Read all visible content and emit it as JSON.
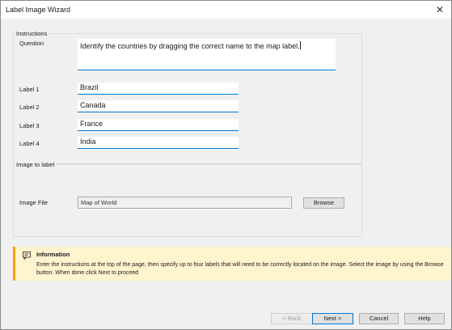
{
  "window": {
    "title": "Label Image Wizard",
    "close_glyph": "✕"
  },
  "instructions": {
    "legend": "Instructions",
    "question_label": "Question",
    "question_value": "Identify the countries by dragging the correct name to the map label.",
    "labels": [
      {
        "label": "Label 1",
        "value": "Brazil"
      },
      {
        "label": "Label 2",
        "value": "Canada"
      },
      {
        "label": "Label 3",
        "value": "France"
      },
      {
        "label": "Label 4",
        "value": "India"
      }
    ]
  },
  "image_section": {
    "legend": "Image to label",
    "file_label": "Image File",
    "file_value": "Map of World",
    "browse_label": "Browse"
  },
  "info": {
    "title": "Information",
    "body": "Enter the instructions at the top of the page, then specify up to four labels that will need to be correctly located on the image. Select the image by using the Browse button. When done click Next to proceed",
    "icon": "info-chat-icon",
    "accent_color": "#f0a30a",
    "background_color": "#fff4ce"
  },
  "buttons": {
    "back": "< Back",
    "next": "Next >",
    "cancel": "Cancel",
    "help": "Help"
  },
  "colors": {
    "focus_accent": "#0078d7",
    "window_bg": "#f0f0f0"
  }
}
